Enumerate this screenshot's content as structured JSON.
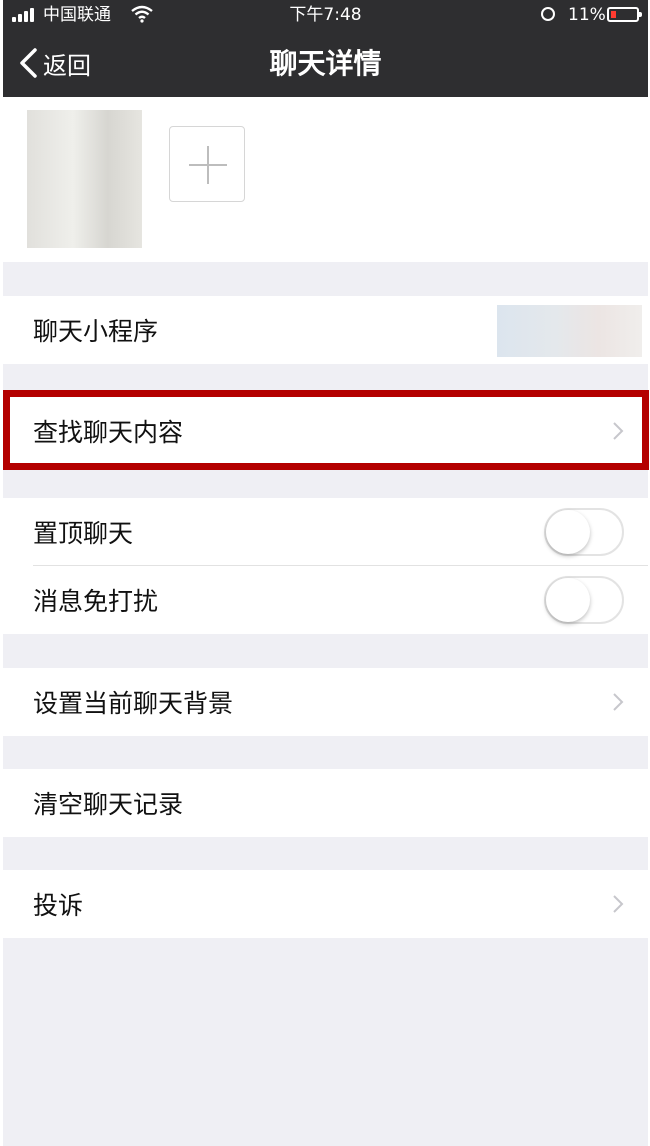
{
  "status_bar": {
    "carrier": "中国联通",
    "time": "下午7:48",
    "battery": "11%"
  },
  "nav": {
    "back_label": "返回",
    "title": "聊天详情"
  },
  "rows": {
    "mini_program": "聊天小程序",
    "search_chat": "查找聊天内容",
    "pin_chat": "置顶聊天",
    "mute": "消息免打扰",
    "set_background": "设置当前聊天背景",
    "clear_history": "清空聊天记录",
    "report": "投诉"
  },
  "toggles": {
    "pin_chat_on": false,
    "mute_on": false
  },
  "colors": {
    "nav_background": "#2e2e30",
    "page_background": "#efeff4",
    "highlight_border": "#b40000",
    "battery_low": "#ff3b30"
  }
}
